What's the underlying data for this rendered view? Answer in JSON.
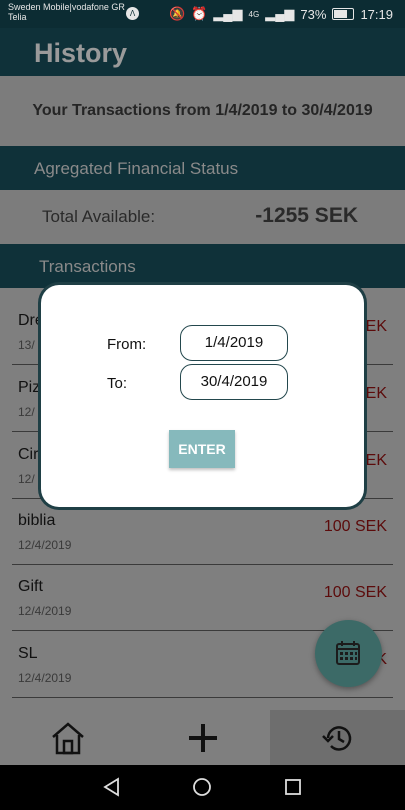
{
  "status_bar": {
    "carrier_line1": "Sweden Mobile|vodafone GR",
    "carrier_line2": "Telia",
    "battery": "73%",
    "time": "17:19",
    "network": "4G"
  },
  "header": {
    "title": "History"
  },
  "range": {
    "text": "Your Transactions from 1/4/2019 to 30/4/2019"
  },
  "financial": {
    "section_title": "Agregated Financial Status",
    "total_label": "Total Available:",
    "total_value": "-1255 SEK"
  },
  "transactions": {
    "section_title": "Transactions",
    "items": [
      {
        "name": "Dre",
        "date": "13/",
        "amount": "EK"
      },
      {
        "name": "Piz",
        "date": "12/",
        "amount": "EK"
      },
      {
        "name": "Cir",
        "date": "12/",
        "amount": "EK"
      },
      {
        "name": "biblia",
        "date": "12/4/2019",
        "amount": "100 SEK"
      },
      {
        "name": "Gift",
        "date": "12/4/2019",
        "amount": "100 SEK"
      },
      {
        "name": "SL",
        "date": "12/4/2019",
        "amount": "K"
      }
    ]
  },
  "dialog": {
    "from_label": "From:",
    "from_value": "1/4/2019",
    "to_label": "To:",
    "to_value": "30/4/2019",
    "enter_label": "ENTER"
  },
  "colors": {
    "header": "#0f3139",
    "accent": "#86b9bc",
    "fab": "#3c6a67",
    "amount": "#5c0b0b"
  }
}
